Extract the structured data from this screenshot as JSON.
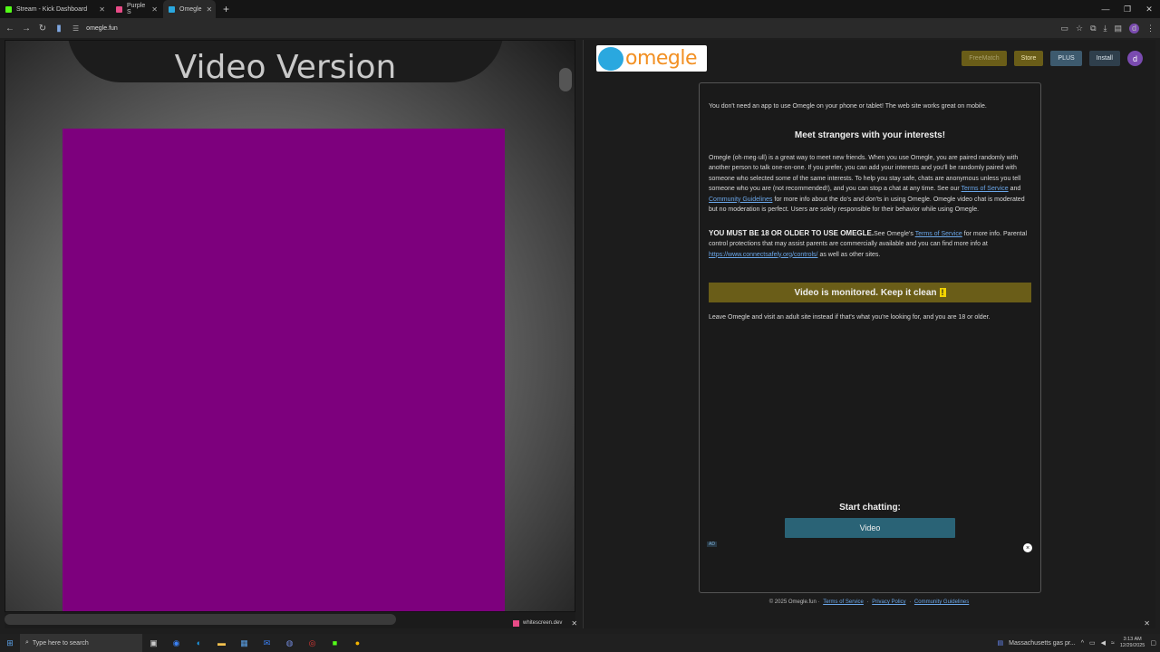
{
  "browser": {
    "tabs": [
      {
        "label": "Stream - Kick Dashboard",
        "color": "#53fc18"
      },
      {
        "label": "Purple S",
        "color": "#e84b87"
      },
      {
        "label": "Omegle",
        "color": "#2aa8df"
      }
    ],
    "url": "omegle.fun",
    "profile_initial": "d"
  },
  "left": {
    "banner_text": "Video Version",
    "fill_color": "#7d007d",
    "download_chip": "whitescreen.dev"
  },
  "omegle": {
    "logo_text": "omegle",
    "nav": {
      "freematch": "FreeMatch",
      "store": "Store",
      "plus": "PLUS",
      "install": "Install",
      "avatar": "d"
    },
    "intro": "You don't need an app to use Omegle on your phone or tablet! The web site works great on mobile.",
    "heading": "Meet strangers with your interests!",
    "para1_a": "Omegle (oh·meg·ull) is a great way to meet new friends. When you use Omegle, you are paired randomly with another person to talk one-on-one. If you prefer, you can add your interests and you'll be randomly paired with someone who selected some of the same interests. To help you stay safe, chats are anonymous unless you tell someone who you are (not recommended!), and you can stop a chat at any time. See our",
    "tos": "Terms of Service",
    "and": "and",
    "guidelines": "Community Guidelines",
    "para1_b": "for more info about the do's and don'ts in using Omegle. Omegle video chat is moderated but no moderation is perfect. Users are solely responsible for their behavior while using Omegle.",
    "age_bold": "YOU MUST BE 18 OR OLDER TO USE OMEGLE.",
    "age_a": "See Omegle's",
    "age_b": "for more info. Parental control protections that may assist parents are commercially available and you can find more info at",
    "controls_link": "https://www.connectsafely.org/controls/",
    "age_c": "as well as other sites.",
    "monitored": "Video is monitored. Keep it clean",
    "monitored_icon": "!",
    "leave": "Leave Omegle and visit an adult site instead if that's what you're looking for, and you are 18 or older.",
    "start_label": "Start chatting:",
    "video_button": "Video",
    "ad_label": "AD",
    "close_ad": "×",
    "footer_copy": "© 2025 Omegle.fun ·",
    "footer_tos": "Terms of Service",
    "footer_privacy": "Privacy Policy",
    "footer_guidelines": "Community Guidelines",
    "sep": "·"
  },
  "taskbar": {
    "search_placeholder": "Type here to search",
    "news": "Massachusetts gas pr...",
    "time": "3:13 AM",
    "date": "12/29/2025"
  }
}
